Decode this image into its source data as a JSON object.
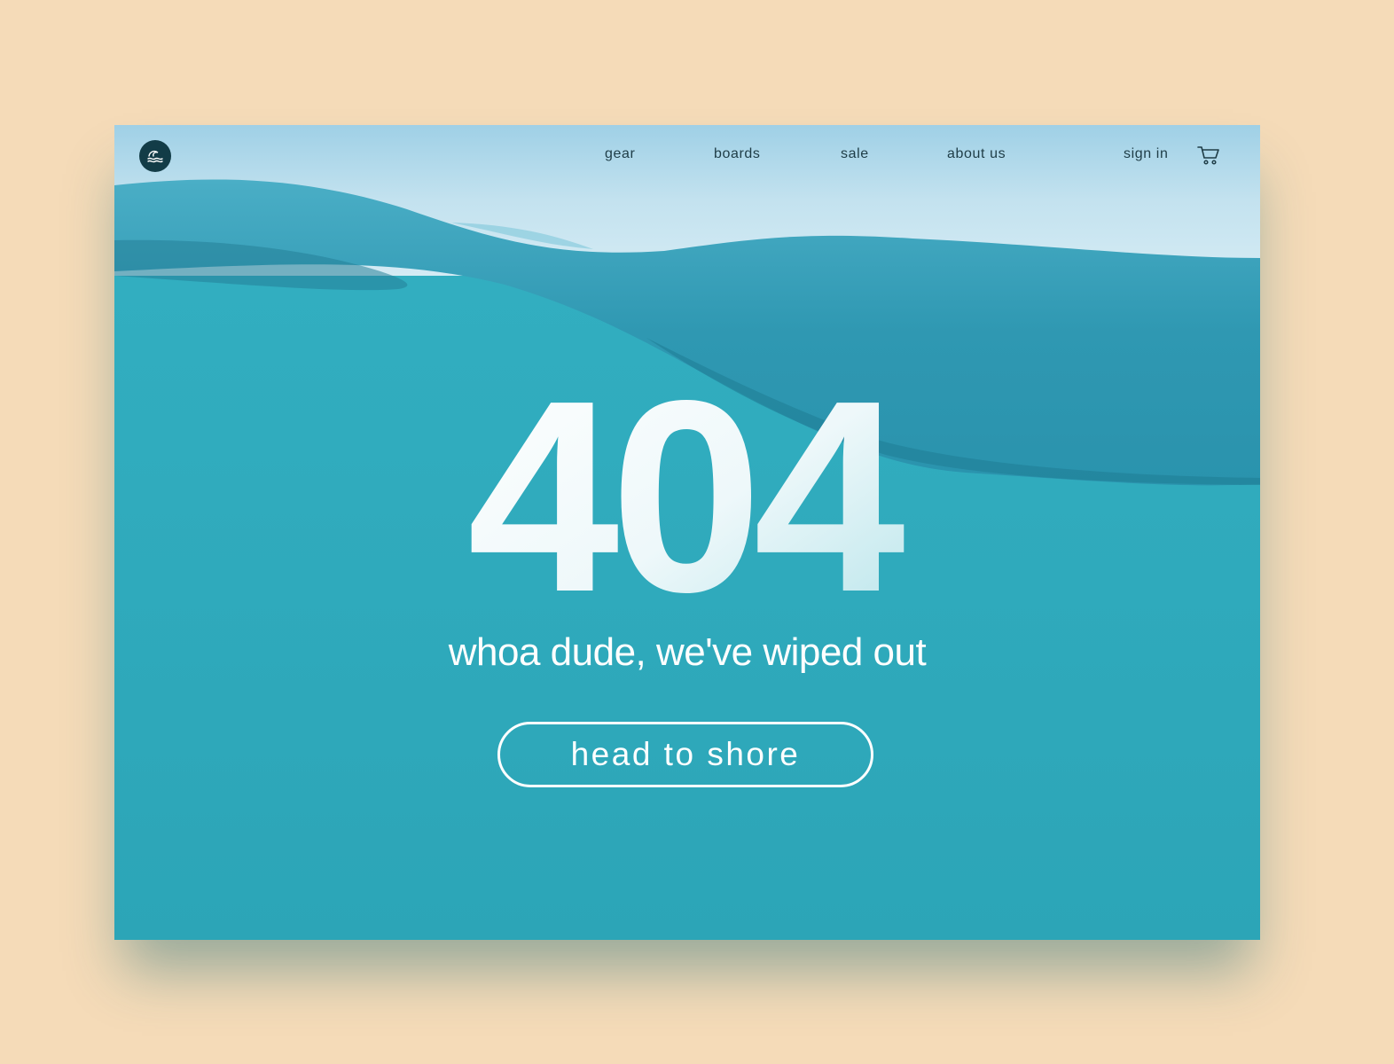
{
  "nav": {
    "logo_icon": "wave-icon",
    "links": [
      {
        "label": "gear"
      },
      {
        "label": "boards"
      },
      {
        "label": "sale"
      },
      {
        "label": "about us"
      }
    ],
    "sign_in": "sign in",
    "cart_icon": "cart-icon"
  },
  "hero": {
    "code": "404",
    "message": "whoa dude, we've wiped out",
    "cta_label": "head to shore"
  },
  "colors": {
    "page_background": "#f5dbb8",
    "water": "#31adbf",
    "sky": "#bfe0ee",
    "logo_background": "#123c47",
    "nav_text": "#1f3d47",
    "text_light": "#ffffff"
  }
}
